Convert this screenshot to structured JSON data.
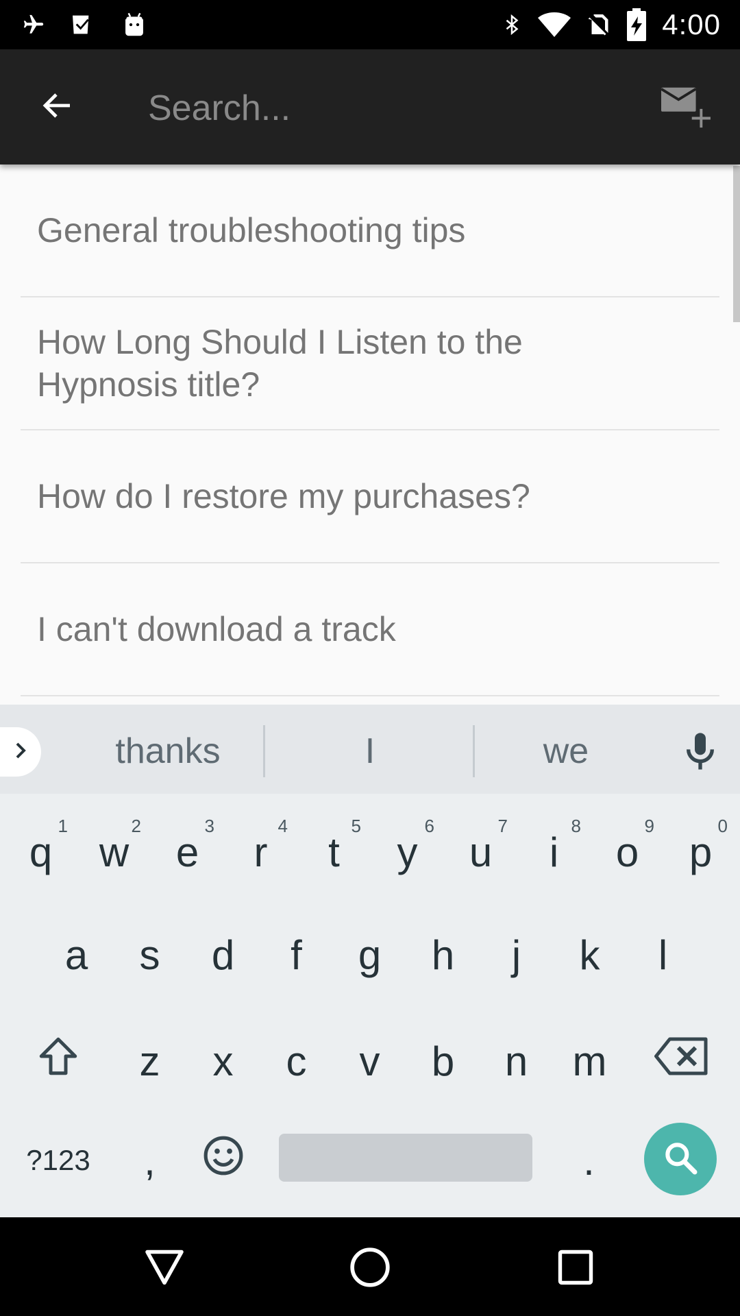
{
  "status_bar": {
    "time": "4:00",
    "icons": [
      "airplane-icon",
      "play-store-icon",
      "android-icon",
      "bluetooth-icon",
      "wifi-icon",
      "no-sim-icon",
      "battery-charging-icon"
    ]
  },
  "toolbar": {
    "search_placeholder": "Search...",
    "back_icon": "arrow-back-icon",
    "compose_icon": "new-message-icon"
  },
  "list": {
    "items": [
      {
        "line1": "General troubleshooting tips",
        "line2": ""
      },
      {
        "line1": "How Long Should I Listen to the",
        "line2": "Hypnosis title?"
      },
      {
        "line1": "How do I restore my purchases?",
        "line2": ""
      },
      {
        "line1": "I can't download a track",
        "line2": ""
      }
    ]
  },
  "keyboard": {
    "suggestions": [
      "thanks",
      "I",
      "we"
    ],
    "row1": [
      "q",
      "w",
      "e",
      "r",
      "t",
      "y",
      "u",
      "i",
      "o",
      "p"
    ],
    "row1_hints": [
      "1",
      "2",
      "3",
      "4",
      "5",
      "6",
      "7",
      "8",
      "9",
      "0"
    ],
    "row2": [
      "a",
      "s",
      "d",
      "f",
      "g",
      "h",
      "j",
      "k",
      "l"
    ],
    "row3": [
      "z",
      "x",
      "c",
      "v",
      "b",
      "n",
      "m"
    ],
    "symbols_label": "?123",
    "comma": ",",
    "period": ".",
    "action_color": "#4db6ac"
  },
  "colors": {
    "toolbar": "#212121",
    "accent": "#4db6ac",
    "list_text": "#757575"
  }
}
